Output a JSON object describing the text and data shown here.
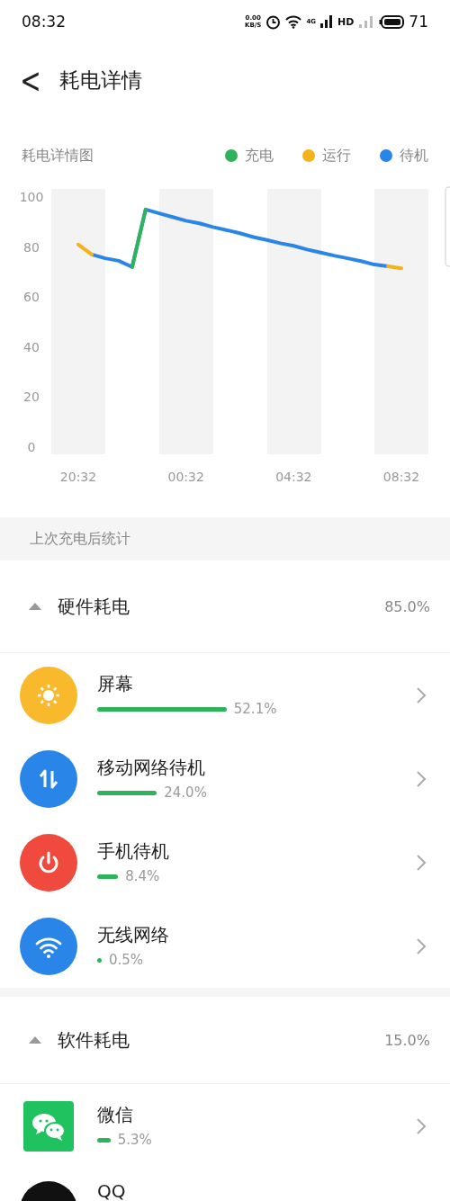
{
  "status_bar": {
    "time": "08:32",
    "net_speed": "0.00",
    "net_unit": "KB/S",
    "network": "4G",
    "hd": "HD",
    "battery": "71"
  },
  "header": {
    "back": "<",
    "title": "耗电详情"
  },
  "chart": {
    "title": "耗电详情图",
    "chart_data": {
      "type": "line",
      "categories": [
        "20:32",
        null,
        null,
        null,
        null,
        null,
        null,
        null,
        "00:32",
        null,
        null,
        null,
        null,
        null,
        null,
        null,
        "04:32",
        null,
        null,
        null,
        null,
        null,
        null,
        null,
        "08:32"
      ],
      "ylim": [
        0,
        100
      ],
      "yticks": [
        0,
        20,
        40,
        60,
        80,
        100
      ],
      "series": [
        {
          "name": "充电",
          "color": "#2fb35a",
          "values": [
            null,
            null,
            null,
            null,
            72,
            95,
            null,
            null,
            null,
            null,
            null,
            null,
            null,
            null,
            null,
            null,
            null,
            null,
            null,
            null,
            null,
            null,
            null,
            null,
            null
          ]
        },
        {
          "name": "运行",
          "color": "#f5b21a",
          "values": [
            81,
            77,
            null,
            null,
            null,
            null,
            null,
            null,
            null,
            null,
            null,
            null,
            null,
            null,
            null,
            null,
            null,
            null,
            null,
            null,
            null,
            null,
            null,
            72.3,
            71.5
          ]
        },
        {
          "name": "待机",
          "color": "#2a85e8",
          "values": [
            null,
            77,
            75.5,
            74.5,
            72,
            95,
            93.5,
            92,
            90.5,
            89.5,
            88,
            86.8,
            85.5,
            84,
            82.8,
            81.5,
            80.5,
            79,
            77.8,
            76.6,
            75.5,
            74.4,
            73,
            72.3,
            null
          ]
        }
      ]
    }
  },
  "since_charge_label": "上次充电后统计",
  "sections": [
    {
      "title": "硬件耗电",
      "expanded": true,
      "percent": "85.0%",
      "items": [
        {
          "kind": "sun",
          "name": "屏幕",
          "reading": "52.1%"
        },
        {
          "kind": "updown",
          "name": "移动网络待机",
          "reading": "24.0%"
        },
        {
          "kind": "power",
          "name": "手机待机",
          "reading": "8.4%"
        },
        {
          "kind": "wifi",
          "name": "无线网络",
          "reading": "0.5%"
        }
      ]
    },
    {
      "title": "软件耗电",
      "expanded": true,
      "percent": "15.0%",
      "items": [
        {
          "kind": "chat",
          "name": "微信",
          "reading": "5.3%"
        },
        {
          "kind": "dark",
          "name": "QQ"
        }
      ]
    }
  ]
}
